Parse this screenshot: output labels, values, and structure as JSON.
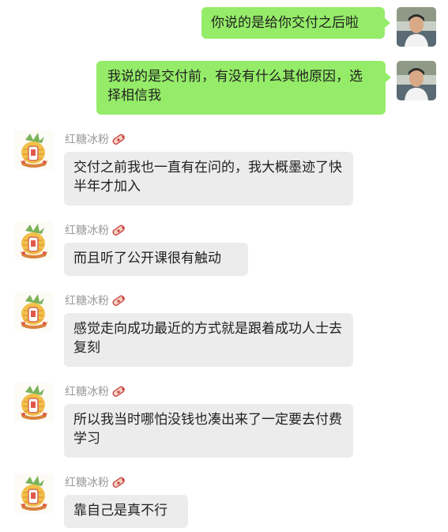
{
  "messages": [
    {
      "side": "right",
      "text": "你说的是给你交付之后啦"
    },
    {
      "side": "right",
      "text": "我说的是交付前，有没有什么其他原因，选择相信我"
    },
    {
      "side": "left",
      "sender": "红糖冰粉",
      "text": "交付之前我也一直有在问的，我大概墨迹了快半年才加入"
    },
    {
      "side": "left",
      "sender": "红糖冰粉",
      "text": "而且听了公开课很有触动"
    },
    {
      "side": "left",
      "sender": "红糖冰粉",
      "text": "感觉走向成功最近的方式就是跟着成功人士去复刻"
    },
    {
      "side": "left",
      "sender": "红糖冰粉",
      "text": "所以我当时哪怕没钱也凑出来了一定要去付费学习"
    },
    {
      "side": "left",
      "sender": "红糖冰粉",
      "text": "靠自己是真不行"
    }
  ],
  "colors": {
    "my_bubble": "#95ec69",
    "other_bubble": "#ececec",
    "sender_name": "#9a9a9a"
  },
  "icons": {
    "self_avatar": "person-photo-avatar",
    "contact_avatar": "pineapple-cartoon-avatar",
    "name_sticker": "bandage-sticker-icon"
  }
}
